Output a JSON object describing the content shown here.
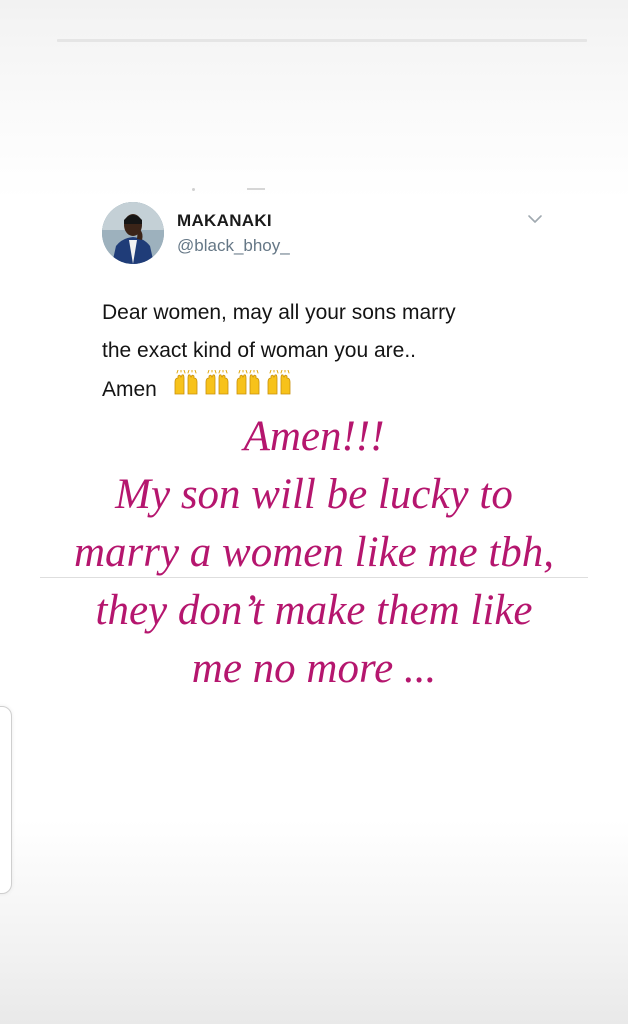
{
  "story": {
    "progress": 1.0
  },
  "tweet": {
    "display_name": "MAKANAKI",
    "handle": "@black_bhoy_",
    "text_lines": [
      "Dear women, may all your sons marry",
      "the exact kind of woman you are.."
    ],
    "amen_text": "Amen",
    "emoji_name": "raising-hands-icon",
    "emoji_count": 4,
    "avatar_icon": "user-avatar-icon",
    "menu_icon": "chevron-down-icon"
  },
  "caption": {
    "lines": [
      "Amen!!!",
      "My son will be lucky to",
      "marry a women like me tbh,",
      "they don’t make them like",
      "me no more ..."
    ],
    "color": "#b5166e"
  },
  "colors": {
    "handle": "#657786",
    "tweet_text": "#141414",
    "emoji": "#f7c21a"
  }
}
